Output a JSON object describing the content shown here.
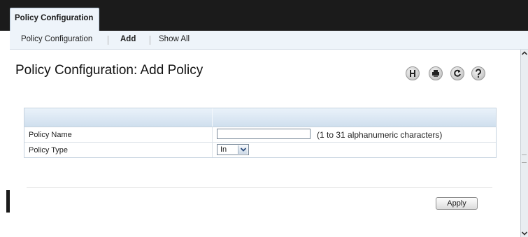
{
  "tab": {
    "label": "Policy Configuration"
  },
  "subnav": {
    "items": [
      "Policy Configuration",
      "Add",
      "Show All"
    ],
    "active": "Add"
  },
  "page": {
    "title": "Policy Configuration: Add Policy"
  },
  "toolbar": {
    "icons": [
      "save-icon",
      "print-icon",
      "refresh-icon",
      "help-icon"
    ]
  },
  "form": {
    "policy_name": {
      "label": "Policy Name",
      "value": "",
      "hint": "(1 to 31 alphanumeric characters)"
    },
    "policy_type": {
      "label": "Policy Type",
      "value": "In"
    }
  },
  "actions": {
    "apply_label": "Apply"
  },
  "colors": {
    "topbar": "#1b1b1b",
    "subnav_bg": "#eef4fa",
    "header_blue": "#cfdfee"
  }
}
